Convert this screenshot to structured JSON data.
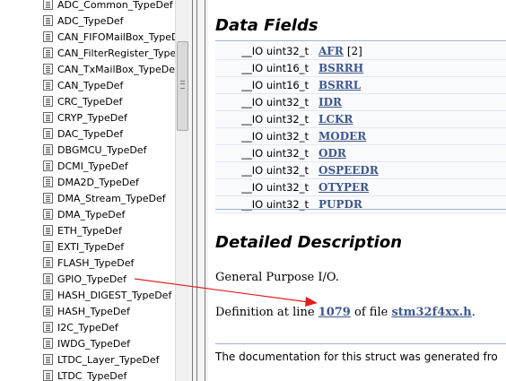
{
  "nav": {
    "items": [
      "ADC_Common_TypeDef",
      "ADC_TypeDef",
      "CAN_FIFOMailBox_TypeDef",
      "CAN_FilterRegister_TypeDef",
      "CAN_TxMailBox_TypeDef",
      "CAN_TypeDef",
      "CRC_TypeDef",
      "CRYP_TypeDef",
      "DAC_TypeDef",
      "DBGMCU_TypeDef",
      "DCMI_TypeDef",
      "DMA2D_TypeDef",
      "DMA_Stream_TypeDef",
      "DMA_TypeDef",
      "ETH_TypeDef",
      "EXTI_TypeDef",
      "FLASH_TypeDef",
      "GPIO_TypeDef",
      "HASH_DIGEST_TypeDef",
      "HASH_TypeDef",
      "I2C_TypeDef",
      "IWDG_TypeDef",
      "LTDC_Layer_TypeDef",
      "LTDC_TypeDef"
    ]
  },
  "content": {
    "data_fields_heading": "Data Fields",
    "fields": [
      {
        "type": "__IO uint32_t",
        "name": "AFR",
        "extra": "[2]"
      },
      {
        "type": "__IO uint16_t",
        "name": "BSRRH",
        "extra": ""
      },
      {
        "type": "__IO uint16_t",
        "name": "BSRRL",
        "extra": ""
      },
      {
        "type": "__IO uint32_t",
        "name": "IDR",
        "extra": ""
      },
      {
        "type": "__IO uint32_t",
        "name": "LCKR",
        "extra": ""
      },
      {
        "type": "__IO uint32_t",
        "name": "MODER",
        "extra": ""
      },
      {
        "type": "__IO uint32_t",
        "name": "ODR",
        "extra": ""
      },
      {
        "type": "__IO uint32_t",
        "name": "OSPEEDR",
        "extra": ""
      },
      {
        "type": "__IO uint32_t",
        "name": "OTYPER",
        "extra": ""
      },
      {
        "type": "__IO uint32_t",
        "name": "PUPDR",
        "extra": ""
      }
    ],
    "detailed_heading": "Detailed Description",
    "description": "General Purpose I/O.",
    "definition": {
      "prefix": "Definition at line",
      "line": "1079",
      "middle": "of file",
      "file": "stm32f4xx.h",
      "suffix": "."
    },
    "footer": "The documentation for this struct was generated fro"
  },
  "colors": {
    "link": "#3d578c",
    "arrow": "#e02020",
    "rule": "#a0b0d0"
  },
  "icons": {
    "nav_item": "document-icon",
    "scroll_grip": "grip-icon"
  }
}
